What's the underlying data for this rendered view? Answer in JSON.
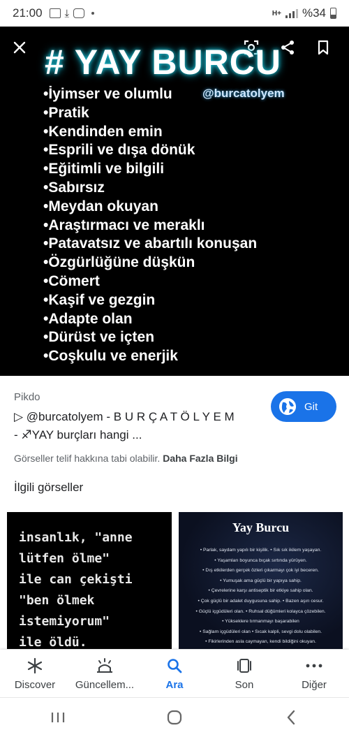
{
  "status_bar": {
    "time": "21:00",
    "battery": "%34"
  },
  "viewer": {
    "title": "# YAY BURCU",
    "handle": "@burcatolyem",
    "traits": [
      "•İyimser ve olumlu",
      "•Pratik",
      "•Kendinden emin",
      "•Esprili ve dışa dönük",
      "•Eğitimli ve bilgili",
      "•Sabırsız",
      "•Meydan okuyan",
      "•Araştırmacı ve meraklı",
      "•Patavatsız ve abartılı konuşan",
      "•Özgürlüğüne düşkün",
      "•Cömert",
      "•Kaşif ve gezgin",
      "•Adapte olan",
      "•Dürüst ve içten",
      "•Coşkulu ve enerjik"
    ]
  },
  "info": {
    "source": "Pikdo",
    "caption_line1": "▷ @burcatolyem - B U R Ç A T Ö L Y E M",
    "caption_line2": "- ♐YAY burçları hangi ...",
    "visit_label": "Git",
    "copyright_text": "Görseller telif hakkına tabi olabilir.",
    "more_info_link": "Daha Fazla Bilgi",
    "related_heading": "İlgili görseller"
  },
  "related": {
    "thumb1_lines": [
      "insanlık, \"anne",
      "lütfen ölme\"",
      "ile can çekişti",
      "\"ben ölmek",
      "istemiyorum\"",
      "ile öldü."
    ],
    "thumb2_title": "Yay Burcu",
    "thumb2_lines": [
      "• Parlak, saydam yapılı bir kişilik. • Sık sık ikilem yaşayan.",
      "• Yaşamları boyunca bıçak sırtında yürüyen.",
      "• Dış etkilerden gerçek özleri çıkarmayı çok iyi beceren.",
      "• Yumuşak ama güçlü bir yapıya sahip.",
      "• Çevrelerine karşı antiseptik bir etkiye sahip olan.",
      "• Çok güçlü bir adalet duygusuna sahip. • Bazen aşırı cesur.",
      "• Güçlü içgüdüleri olan. • Ruhsal düğümleri kolayca çözebilen.",
      "• Yükseklere tırmanmayı başarabilen",
      "• Sağlam içgüdüleri olan • Sıcak kalpli, sevgi dolu olabilen.",
      "• Fikirlerinden asla caymayan, kendi bildiğini okuyan."
    ]
  },
  "bottom_nav": {
    "items": [
      {
        "label": "Discover",
        "icon": "asterisk-icon"
      },
      {
        "label": "Güncellem...",
        "icon": "updates-icon"
      },
      {
        "label": "Ara",
        "icon": "search-icon"
      },
      {
        "label": "Son",
        "icon": "recent-tabs-icon"
      },
      {
        "label": "Diğer",
        "icon": "more-dots-icon"
      }
    ],
    "active_color": "#1a73e8"
  }
}
